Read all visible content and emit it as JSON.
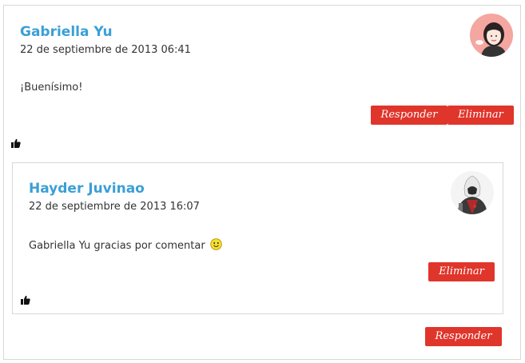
{
  "comment": {
    "author": "Gabriella Yu",
    "date": "22 de septiembre de 2013 06:41",
    "text": "¡Buenísimo!",
    "reply_label": "Responder",
    "delete_label": "Eliminar"
  },
  "reply": {
    "author": "Hayder Juvinao",
    "date": "22 de septiembre de 2013 16:07",
    "text": "Gabriella Yu gracias por comentar",
    "delete_label": "Eliminar"
  },
  "thread_reply_label": "Responder",
  "icons": {
    "like": "thumbs-up-icon",
    "smiley": "smiley-icon"
  },
  "colors": {
    "author_link": "#3a9fd6",
    "button": "#e0352b",
    "border": "#d8d8d8"
  }
}
